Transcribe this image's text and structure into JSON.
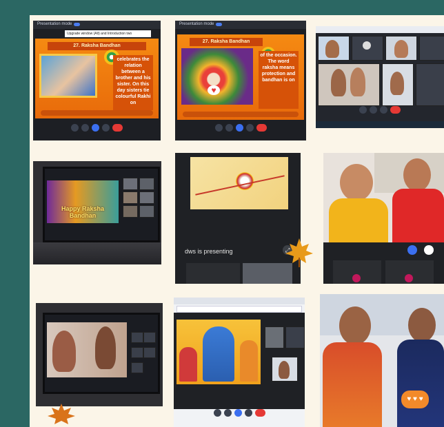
{
  "tile1": {
    "toolbar_text": "Presentation mode",
    "tooltip": "Upgrade window (Alt) and Introduction two",
    "slide_title": "27. Raksha Bandhan",
    "slide_text": "celebrates the relation between a brother and his sister. On this day sisters tie colourful Rakhi on"
  },
  "tile2": {
    "toolbar_text": "Presentation mode",
    "slide_title": "27. Raksha Bandhan",
    "slide_text": "of the occasion. The word raksha means protection and bandhan is on"
  },
  "tile4": {
    "banner": "Happy Raksha Bandhan"
  },
  "tile5": {
    "presenting": "dws is presenting"
  },
  "colors": {
    "page_bg": "#2b6763",
    "board": "#fbf5e8",
    "accent": "#e86a0a",
    "end_call": "#e53935",
    "blue": "#3b6ff0"
  },
  "icons": [
    "maple-leaf-icon",
    "mic-icon",
    "camera-icon",
    "end-call-icon",
    "more-icon",
    "present-icon",
    "chat-heart-icon"
  ]
}
